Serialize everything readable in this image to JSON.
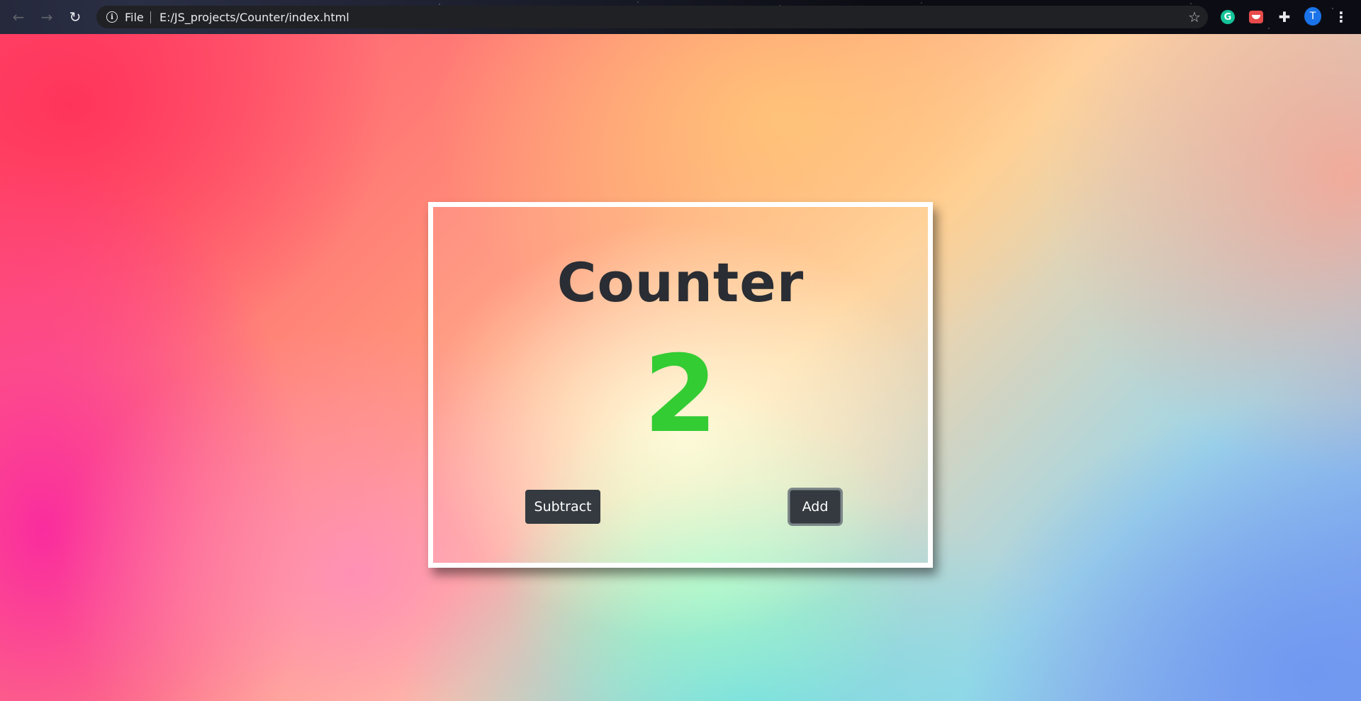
{
  "browser": {
    "nav": {
      "back_icon": "←",
      "forward_icon": "→",
      "reload_icon": "↻"
    },
    "address_bar": {
      "scheme_label": "File",
      "url": "E:/JS_projects/Counter/index.html"
    },
    "extensions": {
      "grammarly_letter": "G",
      "avatar_letter": "T"
    }
  },
  "page": {
    "title": "Counter",
    "counter_value": "2",
    "buttons": {
      "subtract_label": "Subtract",
      "add_label": "Add"
    }
  },
  "colors": {
    "counter_positive": "#33cc33",
    "button_dark": "#343a40",
    "title_text": "#2a2d33"
  }
}
